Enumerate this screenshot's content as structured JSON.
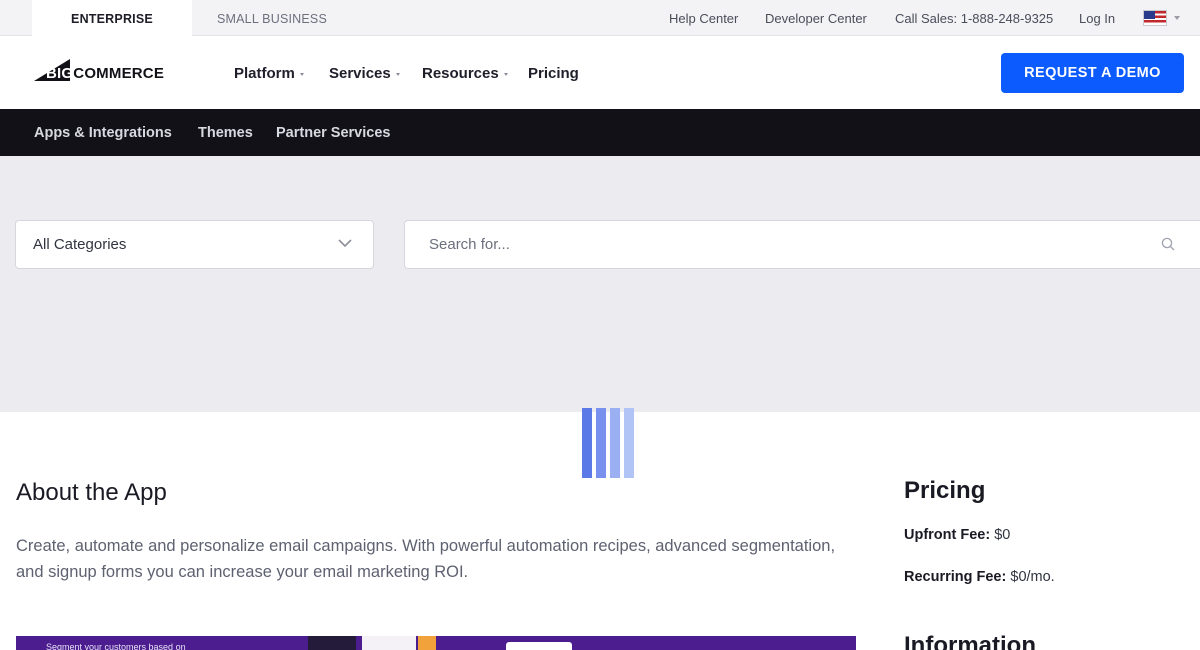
{
  "topbar": {
    "tabs": [
      {
        "label": "ENTERPRISE",
        "active": true
      },
      {
        "label": "SMALL BUSINESS",
        "active": false
      }
    ],
    "help_center": "Help Center",
    "developer_center": "Developer Center",
    "call_sales": "Call Sales: 1-888-248-9325",
    "login": "Log In",
    "flag_icon": "us-flag-icon"
  },
  "header": {
    "logo_big": "BIG",
    "logo_commerce": "COMMERCE",
    "nav": [
      {
        "label": "Platform",
        "dropdown": true
      },
      {
        "label": "Services",
        "dropdown": true
      },
      {
        "label": "Resources",
        "dropdown": true
      },
      {
        "label": "Pricing",
        "dropdown": false
      }
    ],
    "cta_label": "REQUEST A DEMO",
    "cta_color": "#0b5bff"
  },
  "subnav": {
    "items": [
      "Apps & Integrations",
      "Themes",
      "Partner Services"
    ]
  },
  "search": {
    "category_value": "All Categories",
    "placeholder": "Search for..."
  },
  "about": {
    "title": "About the App",
    "description": "Create, automate and personalize email campaigns. With powerful automation recipes, advanced segmentation, and signup forms you can increase your email marketing ROI."
  },
  "pricing": {
    "title": "Pricing",
    "upfront_label": "Upfront Fee:",
    "upfront_value": "$0",
    "recurring_label": "Recurring Fee:",
    "recurring_value": "$0/mo."
  },
  "information": {
    "title": "Information"
  },
  "screenshot": {
    "caption": "Segment your customers based on"
  }
}
